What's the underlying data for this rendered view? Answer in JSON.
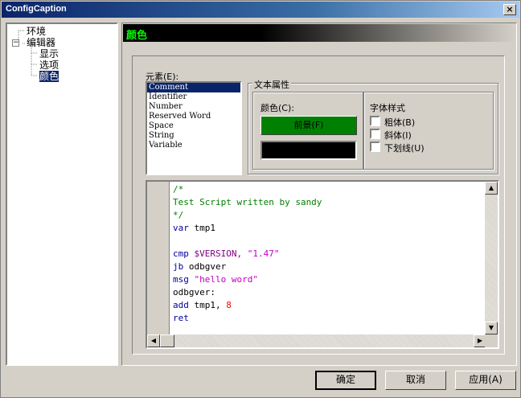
{
  "window": {
    "title": "ConfigCaption",
    "close_glyph": "×"
  },
  "tree": {
    "items": [
      {
        "label": "环境"
      },
      {
        "label": "编辑器",
        "expander": "−"
      },
      {
        "label": "显示"
      },
      {
        "label": "选项"
      },
      {
        "label": "颜色"
      }
    ]
  },
  "panel": {
    "title": "颜色"
  },
  "elements": {
    "label": "元素(E):",
    "items": [
      "Comment",
      "Identifier",
      "Number",
      "Reserved Word",
      "Space",
      "String",
      "Variable"
    ],
    "selected": "Comment"
  },
  "text_attrs": {
    "legend": "文本属性",
    "color_label": "颜色(C):",
    "foreground_label": "前景(F)",
    "foreground_color": "#008000",
    "background_color": "#000000",
    "font_style_label": "字体样式",
    "bold_label": "粗体(B)",
    "italic_label": "斜体(I)",
    "underline_label": "下划线(U)"
  },
  "editor": {
    "lines": [
      {
        "text": "/*",
        "color": "#008000"
      },
      {
        "text": "Test Script written by sandy",
        "color": "#008000"
      },
      {
        "text": "*/",
        "color": "#008000"
      },
      {
        "parts": [
          [
            "var",
            "#0000a0"
          ],
          [
            " tmp1",
            "#000000"
          ]
        ]
      },
      {
        "text": "",
        "color": "#000000"
      },
      {
        "parts": [
          [
            "cmp",
            "#0000a0"
          ],
          [
            " $VERSION, ",
            "#800080"
          ],
          [
            "\"1.47\"",
            "#c000c0"
          ]
        ]
      },
      {
        "parts": [
          [
            "jb",
            "#0000a0"
          ],
          [
            " odbgver",
            "#000000"
          ]
        ]
      },
      {
        "parts": [
          [
            "msg",
            "#0000a0"
          ],
          [
            " ",
            "#000000"
          ],
          [
            "\"hello word\"",
            "#c000c0"
          ]
        ]
      },
      {
        "text": "odbgver:",
        "color": "#000000"
      },
      {
        "parts": [
          [
            "add",
            "#0000a0"
          ],
          [
            " tmp1, ",
            "#000000"
          ],
          [
            "8",
            "#ff0000"
          ]
        ]
      },
      {
        "parts": [
          [
            "ret",
            "#0000a0"
          ]
        ]
      }
    ]
  },
  "buttons": {
    "ok": "确定",
    "cancel": "取消",
    "apply": "应用(A)"
  }
}
